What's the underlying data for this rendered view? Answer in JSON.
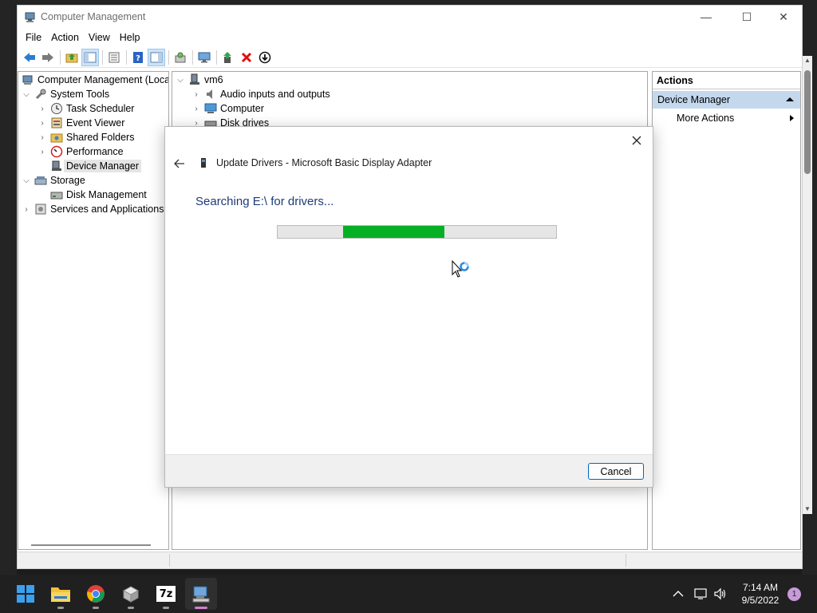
{
  "window": {
    "title": "Computer Management",
    "controls": {
      "minimize": "—",
      "maximize": "☐",
      "close": "✕"
    }
  },
  "menu": [
    "File",
    "Action",
    "View",
    "Help"
  ],
  "toolbar_icons": [
    "back-arrow-icon",
    "forward-arrow-icon",
    "up-folder-icon",
    "show-hide-tree-icon",
    "properties-icon",
    "help-icon",
    "action-pane-icon",
    "scan-hardware-icon",
    "monitor-icon",
    "update-driver-icon",
    "uninstall-icon",
    "disable-device-icon"
  ],
  "tree": {
    "root": "Computer Management (Local",
    "system_tools": "System Tools",
    "task_scheduler": "Task Scheduler",
    "event_viewer": "Event Viewer",
    "shared_folders": "Shared Folders",
    "performance": "Performance",
    "device_manager": "Device Manager",
    "storage": "Storage",
    "disk_management": "Disk Management",
    "services": "Services and Applications"
  },
  "devices": {
    "host": "vm6",
    "items": [
      "Audio inputs and outputs",
      "Computer",
      "Disk drives"
    ]
  },
  "actions": {
    "header": "Actions",
    "section": "Device Manager",
    "more": "More Actions"
  },
  "dialog": {
    "title": "Update Drivers - Microsoft Basic Display Adapter",
    "status": "Searching E:\\ for drivers...",
    "progress": {
      "start_fraction": 0.235,
      "end_fraction": 0.6,
      "color": "#06b025"
    },
    "cancel": "Cancel"
  },
  "taskbar": {
    "apps": [
      "windows-start-icon",
      "file-explorer-icon",
      "chrome-icon",
      "package-icon",
      "7zip-icon",
      "computer-management-icon"
    ],
    "seven_zip_label": "7z",
    "time": "7:14 AM",
    "date": "9/5/2022",
    "notifications": "1"
  }
}
